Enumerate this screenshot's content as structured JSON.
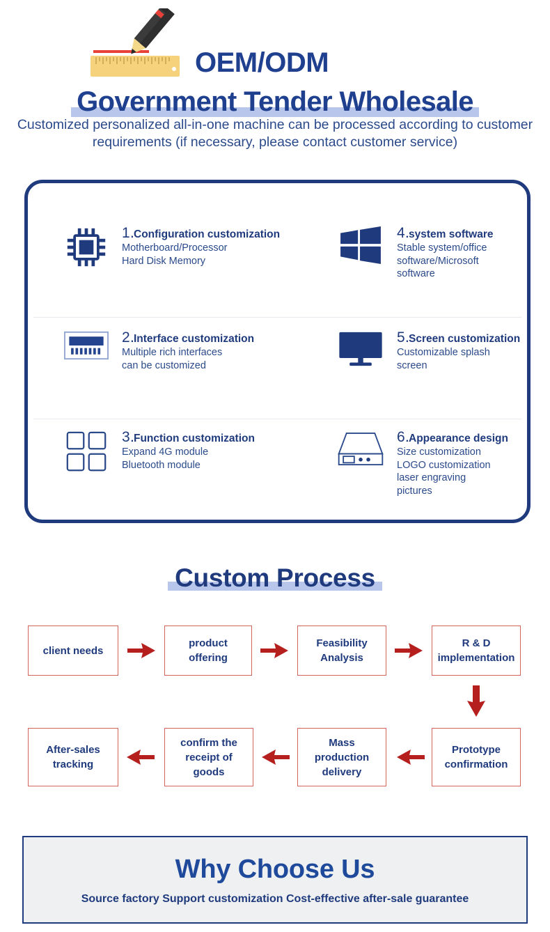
{
  "hero": {
    "icon": "pencil-ruler-icon",
    "oem_label": "OEM/ODM",
    "title": "Government Tender Wholesale",
    "subtitle": "Customized personalized all-in-one\nmachine can be processed according to customer requirements\n(if necessary, please contact customer service)",
    "accent_color": "#1f3f8f",
    "highlight_color": "#b9c6ec"
  },
  "features": {
    "border_color": "#1f3a7d",
    "items": [
      {
        "number": "1",
        "separator": ".",
        "title": "Configuration customization",
        "body": "Motherboard/Processor\nHard Disk Memory",
        "icon": "cpu-chip-icon"
      },
      {
        "number": "2",
        "separator": ".",
        "title": "Interface customization",
        "body": "Multiple rich interfaces\ncan be customized",
        "icon": "ram-module-icon"
      },
      {
        "number": "3",
        "separator": ".",
        "title": "Function customization",
        "body": "Expand 4G module\nBluetooth module",
        "icon": "four-squares-icon"
      },
      {
        "number": "4",
        "separator": ".",
        "title": "system software",
        "body": "Stable system/office\nsoftware/Microsoft\nsoftware",
        "icon": "windows-logo-icon"
      },
      {
        "number": "5",
        "separator": ".",
        "title": "Screen customization",
        "body": "Customizable splash\nscreen",
        "icon": "monitor-icon"
      },
      {
        "number": "6",
        "separator": ".",
        "title": "Appearance design",
        "body": "Size customization\nLOGO customization\nlaser engraving\npictures",
        "icon": "device-chassis-icon"
      }
    ]
  },
  "process": {
    "title": "Custom Process",
    "highlight_color": "#b9c6ec",
    "box_border_color": "#d4625c",
    "arrow_color": "#b5201f",
    "steps": [
      {
        "label": "client needs",
        "row": 1,
        "order": 1
      },
      {
        "label": "product\noffering",
        "row": 1,
        "order": 2
      },
      {
        "label": "Feasibility\nAnalysis",
        "row": 1,
        "order": 3
      },
      {
        "label": "R & D\nimplementation",
        "row": 1,
        "order": 4
      },
      {
        "label": "Prototype\nconfirmation",
        "row": 2,
        "order": 5
      },
      {
        "label": "Mass\nproduction\ndelivery",
        "row": 2,
        "order": 6
      },
      {
        "label": "confirm the\nreceipt of\ngoods",
        "row": 2,
        "order": 7
      },
      {
        "label": "After-sales\ntracking",
        "row": 2,
        "order": 8
      }
    ]
  },
  "why": {
    "title": "Why Choose Us",
    "subtitle": "Source factory Support customization Cost-effective after-sale guarantee",
    "background_color": "#eff0f1",
    "border_color": "#1f3a7d"
  }
}
